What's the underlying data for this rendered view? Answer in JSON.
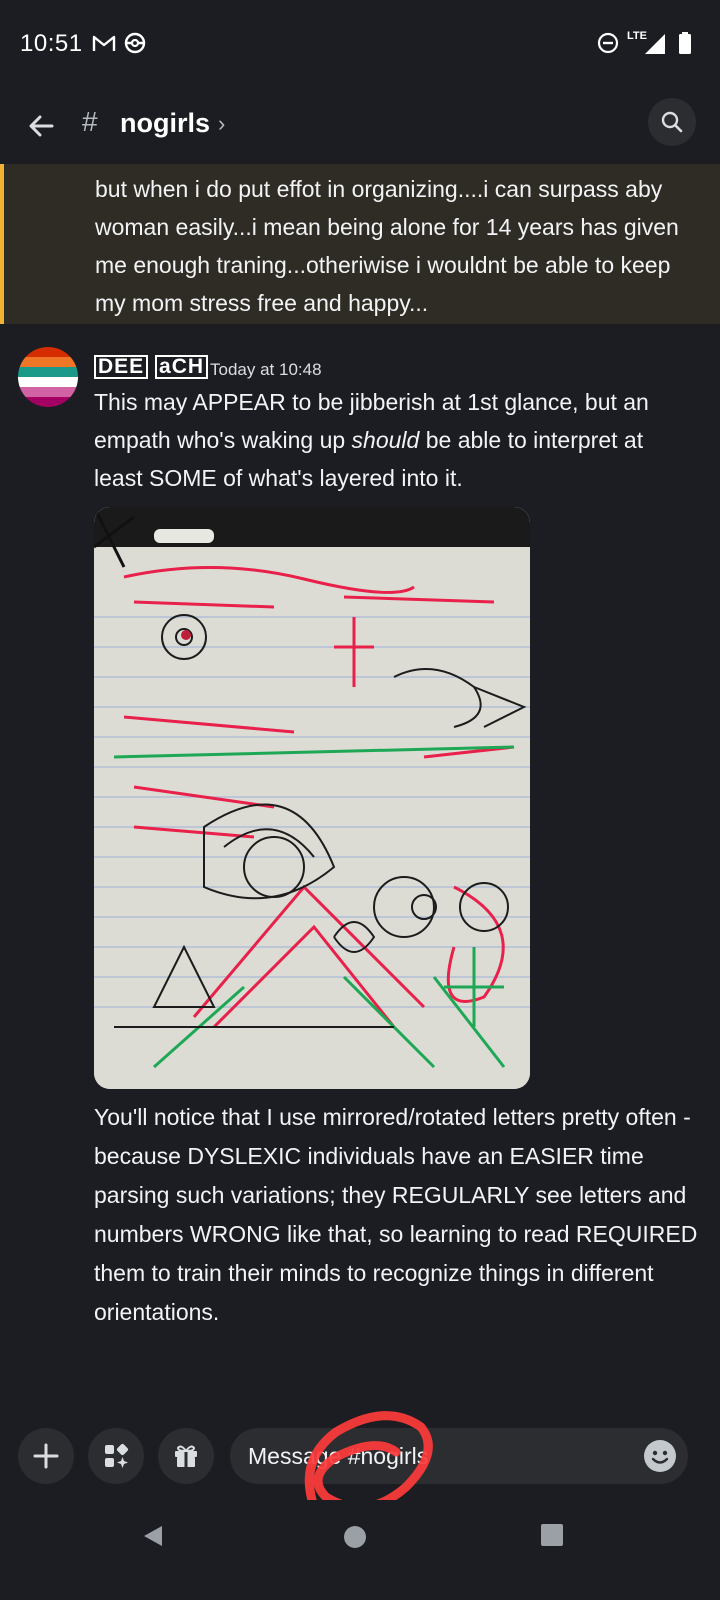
{
  "status_bar": {
    "time": "10:51",
    "network": "LTE",
    "icons": [
      "gmail-icon",
      "game-controller-icon",
      "do-not-disturb-icon",
      "signal-icon",
      "battery-icon"
    ]
  },
  "header": {
    "back_icon": "arrow-left-icon",
    "channel_prefix": "#",
    "channel_name": "nogirls",
    "chevron": "›",
    "search_icon": "search-icon"
  },
  "previous_message": {
    "text": "but when i do put effot in organizing....i can surpass aby woman easily...i mean being alone for 14 years has given me enough traning...otheriwise i wouldnt be able to keep my mom stress free and happy...",
    "highlight_color": "#f0b232"
  },
  "message": {
    "author": "DEE",
    "author_rest": "aCH",
    "timestamp": "Today at 10:48",
    "text_part1": "This may APPEAR to be jibberish at 1st glance, but an empath who's waking up ",
    "text_italic": "should",
    "text_part2": " be able to interpret at least SOME of what's layered into it.",
    "attachment_icon": "hand-drawn-sketch-image",
    "followup_text": "You'll notice that I use mirrored/rotated letters pretty often - because DYSLEXIC individuals have an EASIER time parsing such variations; they REGULARLY see letters and numbers WRONG like that, so learning to read REQUIRED them to train their minds to recognize things in different orientations."
  },
  "composer": {
    "placeholder": "Message #nogirls",
    "buttons": [
      "plus-icon",
      "apps-icon",
      "gift-icon",
      "emoji-icon"
    ]
  },
  "colors": {
    "background": "#1c1d22",
    "surface": "#2b2d31",
    "accent_highlight": "#f0b232",
    "scribble": "#ff3b3b"
  }
}
